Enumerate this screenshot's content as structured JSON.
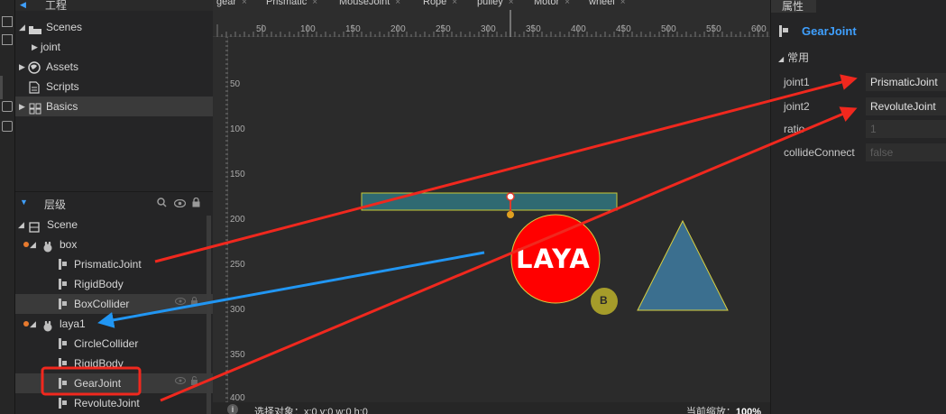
{
  "project": {
    "title": "工程",
    "items": [
      {
        "label": "Scenes",
        "icon": "folder-scenes-icon"
      },
      {
        "label": "joint",
        "icon": "none"
      },
      {
        "label": "Assets",
        "icon": "globe-icon"
      },
      {
        "label": "Scripts",
        "icon": "script-file-icon"
      },
      {
        "label": "Basics",
        "icon": "basics-grid-icon"
      }
    ]
  },
  "hierarchy": {
    "title": "层级",
    "nodes": [
      {
        "label": "Scene"
      },
      {
        "label": "box"
      },
      {
        "label": "PrismaticJoint"
      },
      {
        "label": "RigidBody"
      },
      {
        "label": "BoxCollider"
      },
      {
        "label": "laya1"
      },
      {
        "label": "CircleCollider"
      },
      {
        "label": "RigidBody"
      },
      {
        "label": "GearJoint"
      },
      {
        "label": "RevoluteJoint"
      }
    ]
  },
  "tabs": [
    "gear",
    "Prismatic",
    "MouseJoint",
    "Rope",
    "pulley",
    "Motor",
    "wheel"
  ],
  "ruler": {
    "x_ticks": [
      "50",
      "100",
      "150",
      "200",
      "250",
      "300",
      "350",
      "400",
      "450",
      "500",
      "550",
      "600"
    ],
    "y_ticks": [
      "50",
      "100",
      "150",
      "200",
      "250",
      "300",
      "350",
      "400"
    ]
  },
  "canvas": {
    "logo_text": "LAYA",
    "badge_text": "B"
  },
  "status": {
    "selection": "选择对象：x:0 y:0  w:0 h:0",
    "zoom_label": "当前缩放：",
    "zoom_value": "100%",
    "info_glyph": "i"
  },
  "properties": {
    "tab": "属性",
    "component": "GearJoint",
    "group": "常用",
    "fields": [
      {
        "key": "joint1",
        "value": "PrismaticJoint",
        "dim": false
      },
      {
        "key": "joint2",
        "value": "RevoluteJoint",
        "dim": false
      },
      {
        "key": "ratio",
        "value": "1",
        "dim": true
      },
      {
        "key": "collideConnect",
        "value": "false",
        "dim": true
      }
    ]
  },
  "colors": {
    "accent": "#3fa0ff",
    "arrow_red": "#f0281e",
    "arrow_blue": "#2196f3",
    "box_fill": "#2f6a72",
    "circle_fill": "#ff0000",
    "triangle_fill": "#3b6f8f",
    "badge_fill": "#a59c2a"
  }
}
